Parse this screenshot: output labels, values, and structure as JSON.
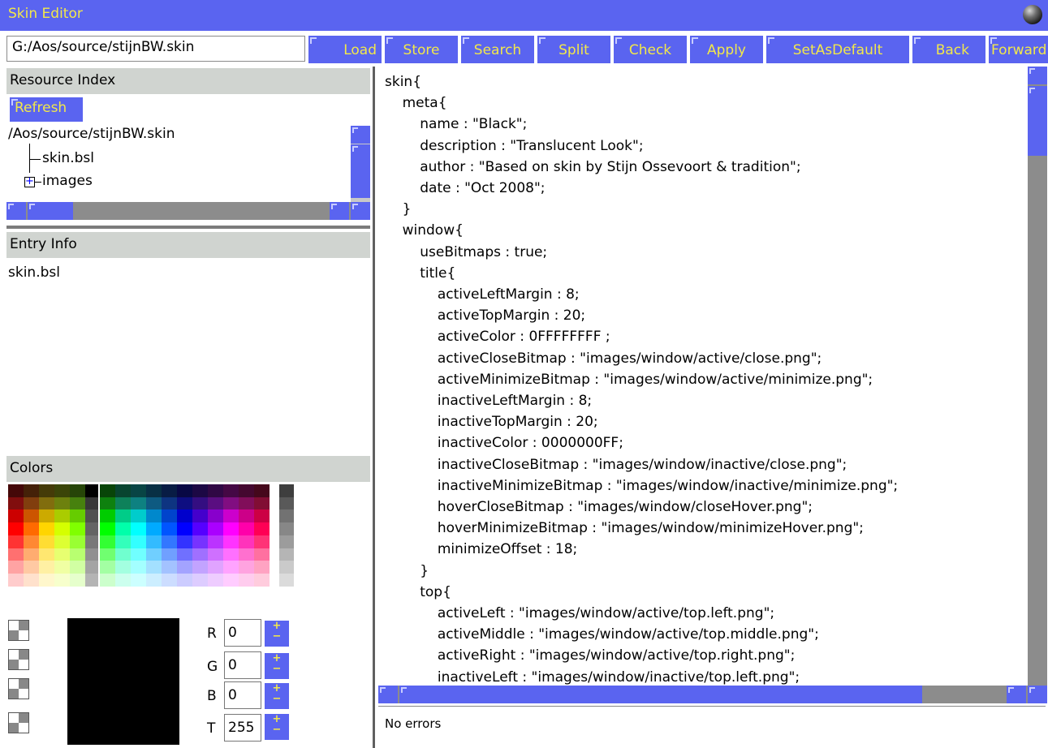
{
  "window": {
    "title": "Skin Editor"
  },
  "path_field": {
    "value": "G:/Aos/source/stijnBW.skin"
  },
  "toolbar": {
    "buttons": [
      "Load",
      "Store",
      "Search",
      "Split",
      "Check",
      "Apply",
      "SetAsDefault",
      "Back",
      "Forward"
    ]
  },
  "resource_index": {
    "header": "Resource Index",
    "refresh_label": "Refresh",
    "root": "/Aos/source/stijnBW.skin",
    "items": [
      "skin.bsl",
      "images"
    ]
  },
  "entry_info": {
    "header": "Entry Info",
    "value": "skin.bsl"
  },
  "colors": {
    "header": "Colors",
    "r": {
      "label": "R",
      "value": "0"
    },
    "g": {
      "label": "G",
      "value": "0"
    },
    "b": {
      "label": "B",
      "value": "0"
    },
    "t": {
      "label": "T",
      "value": "255"
    },
    "current_color": "#000000"
  },
  "editor": {
    "lines": [
      "skin{",
      "    meta{",
      "        name : \"Black\";",
      "        description : \"Translucent Look\";",
      "        author : \"Based on skin by Stijn Ossevoort & tradition\";",
      "        date : \"Oct 2008\";",
      "    }",
      "    window{",
      "        useBitmaps : true;",
      "        title{",
      "            activeLeftMargin : 8;",
      "            activeTopMargin : 20;",
      "            activeColor : 0FFFFFFFF ;",
      "            activeCloseBitmap : \"images/window/active/close.png\";",
      "            activeMinimizeBitmap : \"images/window/active/minimize.png\";",
      "            inactiveLeftMargin : 8;",
      "            inactiveTopMargin : 20;",
      "            inactiveColor : 0000000FF;",
      "            inactiveCloseBitmap : \"images/window/inactive/close.png\";",
      "            inactiveMinimizeBitmap : \"images/window/inactive/minimize.png\";",
      "            hoverCloseBitmap : \"images/window/closeHover.png\";",
      "            hoverMinimizeBitmap : \"images/window/minimizeHover.png\";",
      "            minimizeOffset : 18;",
      "        }",
      "        top{",
      "            activeLeft : \"images/window/active/top.left.png\";",
      "            activeMiddle : \"images/window/active/top.middle.png\";",
      "            activeRight : \"images/window/active/top.right.png\";",
      "            inactiveLeft : \"images/window/inactive/top.left.png\";"
    ]
  },
  "status": {
    "message": "No errors"
  },
  "theme": {
    "accent": "#5a64f0",
    "button_text": "#f2e84a",
    "panel_header": "#d0d4d0"
  }
}
